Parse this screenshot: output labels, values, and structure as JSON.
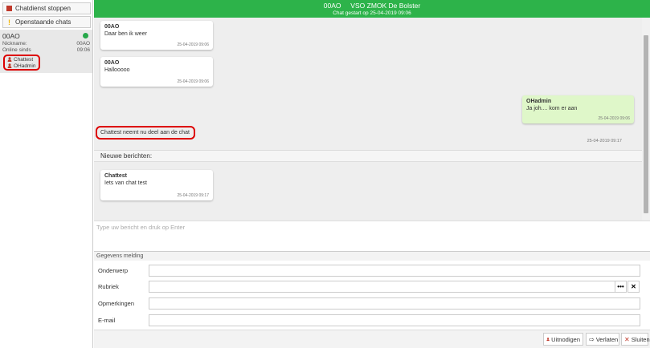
{
  "sidebar": {
    "stop_label": "Chatdienst stoppen",
    "open_label": "Openstaande chats",
    "chat": {
      "title": "00AO",
      "nickname_label": "Nickname:",
      "nickname_value": "00AO",
      "online_label": "Online sinds",
      "online_value": "09:06",
      "participants": [
        "Chattest",
        "OHadmin"
      ]
    }
  },
  "header": {
    "title": "00AO     VSO ZMOK De Bolster",
    "subtitle": "Chat gestart op 25-04-2019 09:06"
  },
  "messages": [
    {
      "sender": "00AO",
      "text": "Daar ben ik weer",
      "time": "25-04-2019 09:06"
    },
    {
      "sender": "00AO",
      "text": "Hallooooo",
      "time": "25-04-2019 09:06"
    },
    {
      "sender": "OHadmin",
      "text": "Ja joh.... kom er aan",
      "time": "25-04-2019 09:06"
    }
  ],
  "system_message": {
    "text": "Chattest neemt nu deel aan de chat",
    "time": "25-04-2019 09:17"
  },
  "new_messages_label": "Nieuwe berichten:",
  "new_message": {
    "sender": "Chattest",
    "text": "Iets van chat test",
    "time": "25-04-2019 09:17"
  },
  "input": {
    "placeholder": "Type uw bericht en druk op Enter"
  },
  "form": {
    "heading": "Gegevens melding",
    "subject_label": "Onderwerp",
    "category_label": "Rubriek",
    "remarks_label": "Opmerkingen",
    "email_label": "E-mail",
    "more_label": "•••",
    "clear_label": "✕"
  },
  "footer": {
    "invite_label": "Uitnodigen",
    "leave_label": "Verlaten",
    "close_label": "Sluiten"
  },
  "colors": {
    "header": "#2db34a",
    "own_bubble": "#dff7c9",
    "highlight": "#dd0000",
    "online": "#27a84a"
  }
}
